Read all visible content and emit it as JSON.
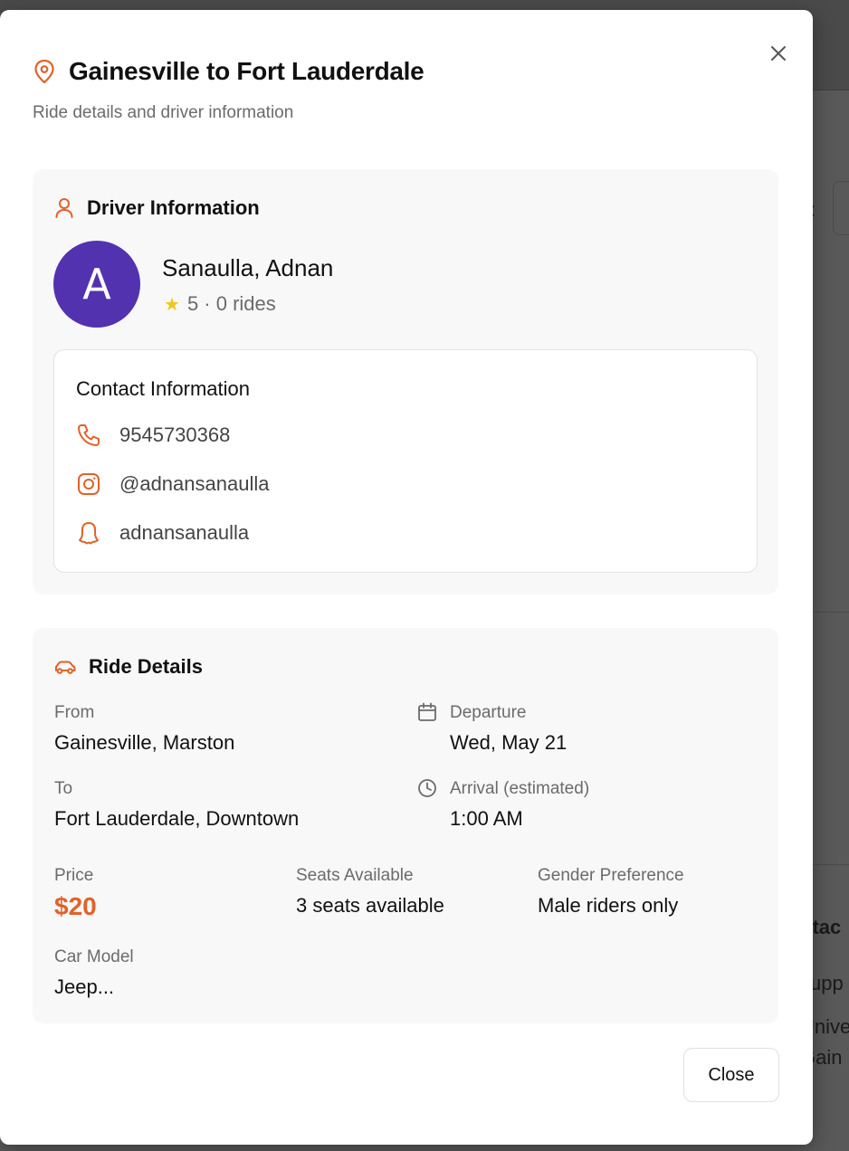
{
  "modal": {
    "title": "Gainesville to Fort Lauderdale",
    "subtitle": "Ride details and driver information",
    "close_label": "Close"
  },
  "driver": {
    "section_title": "Driver Information",
    "avatar_letter": "A",
    "name": "Sanaulla, Adnan",
    "rating": "5 · 0 rides",
    "contact": {
      "title": "Contact Information",
      "phone": "9545730368",
      "instagram": "@adnansanaulla",
      "snapchat": "adnansanaulla"
    }
  },
  "ride": {
    "section_title": "Ride Details",
    "from_label": "From",
    "from_value": "Gainesville, Marston",
    "to_label": "To",
    "to_value": "Fort Lauderdale, Downtown",
    "departure_label": "Departure",
    "departure_value": "Wed, May 21",
    "arrival_label": "Arrival (estimated)",
    "arrival_value": "1:00 AM",
    "price_label": "Price",
    "price_value": "$20",
    "seats_label": "Seats Available",
    "seats_value": "3 seats available",
    "gender_label": "Gender Preference",
    "gender_value": "Male riders only",
    "car_label": "Car Model",
    "car_value": "Jeep..."
  },
  "background": {
    "text_1": "y:",
    "text_2": "ntac",
    "text_3": "supp",
    "text_4": "Unive",
    "text_5": "Gain"
  },
  "colors": {
    "accent": "#e0622a",
    "avatar": "#5332b0",
    "star": "#f5c518"
  }
}
